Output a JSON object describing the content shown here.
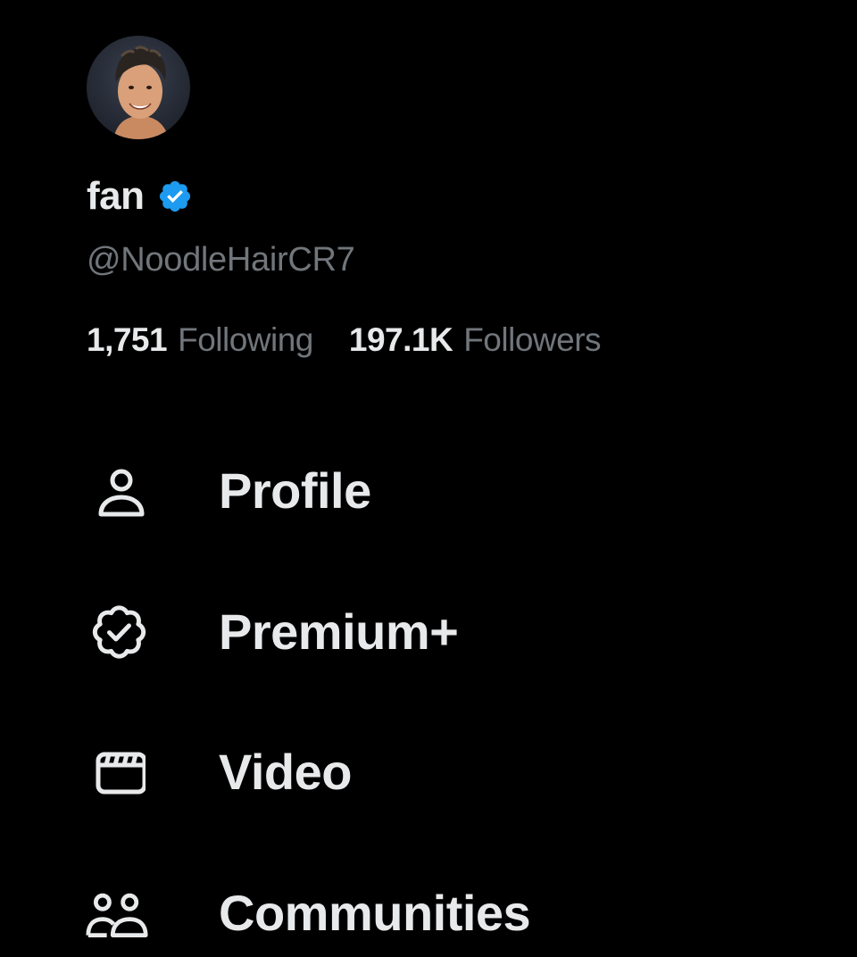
{
  "profile": {
    "display_name": "fan",
    "verified_icon": "verified-badge-icon",
    "handle": "@NoodleHairCR7",
    "avatar_icon": "avatar-portrait"
  },
  "stats": {
    "following_count": "1,751",
    "following_label": "Following",
    "followers_count": "197.1K",
    "followers_label": "Followers"
  },
  "menu": {
    "items": [
      {
        "label": "Profile",
        "icon": "person-icon"
      },
      {
        "label": "Premium+",
        "icon": "verified-badge-outline-icon"
      },
      {
        "label": "Video",
        "icon": "video-clapper-icon"
      },
      {
        "label": "Communities",
        "icon": "communities-icon"
      }
    ]
  },
  "colors": {
    "background": "#000000",
    "primary_text": "#e7e9ea",
    "secondary_text": "#71767b",
    "verified_blue": "#1d9bf0"
  }
}
